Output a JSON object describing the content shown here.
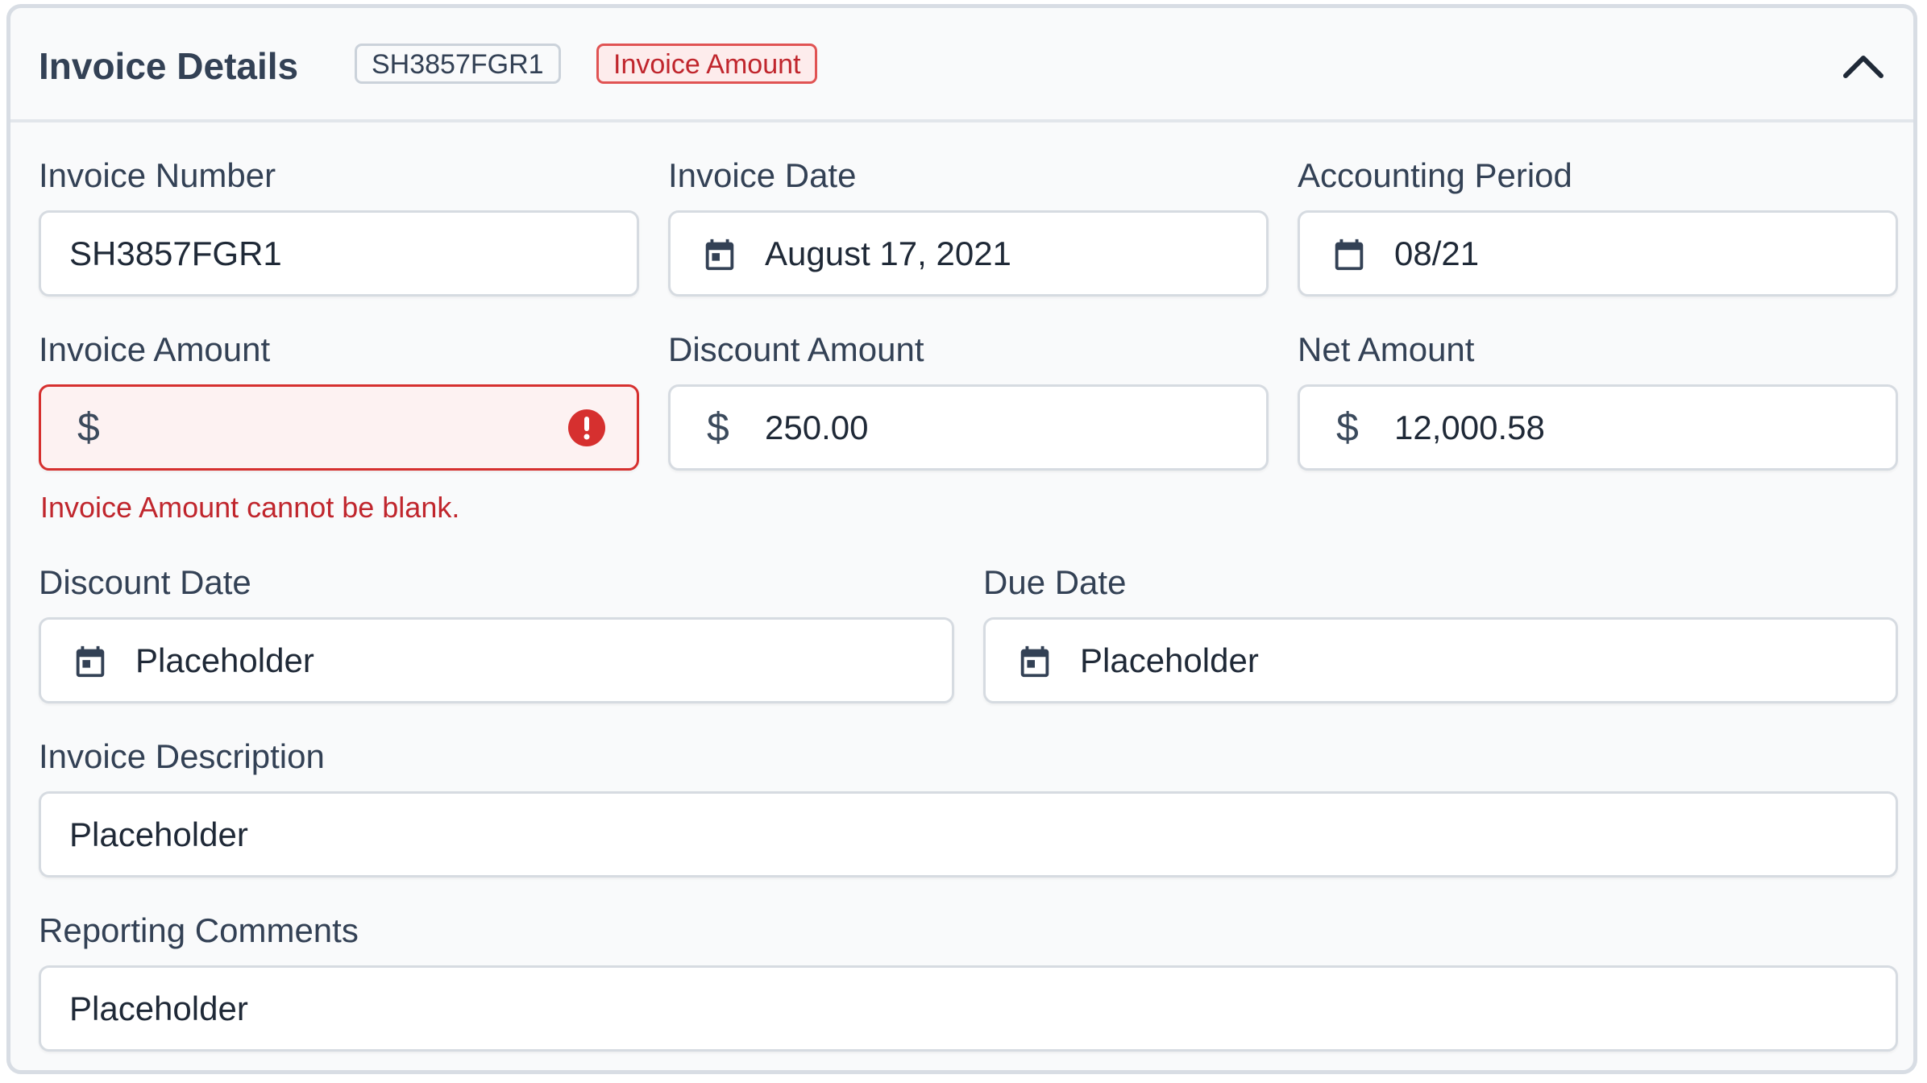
{
  "header": {
    "title": "Invoice Details",
    "badges": {
      "invoice_id": "SH3857FGR1",
      "error_tag": "Invoice Amount"
    },
    "collapse_icon": "chevron-up-icon"
  },
  "fields": {
    "invoice_number": {
      "label": "Invoice Number",
      "value": "SH3857FGR1"
    },
    "invoice_date": {
      "label": "Invoice Date",
      "value": "August 17, 2021",
      "icon": "calendar-icon"
    },
    "accounting_period": {
      "label": "Accounting Period",
      "value": "08/21",
      "icon": "calendar-icon"
    },
    "invoice_amount": {
      "label": "Invoice Amount",
      "prefix": "$",
      "value": "",
      "error": "Invoice Amount cannot be blank.",
      "icon": "error-icon"
    },
    "discount_amount": {
      "label": "Discount Amount",
      "prefix": "$",
      "value": "250.00"
    },
    "net_amount": {
      "label": "Net Amount",
      "prefix": "$",
      "value": "12,000.58"
    },
    "discount_date": {
      "label": "Discount Date",
      "placeholder": "Placeholder",
      "icon": "calendar-icon"
    },
    "due_date": {
      "label": "Due Date",
      "placeholder": "Placeholder",
      "icon": "calendar-icon"
    },
    "invoice_description": {
      "label": "Invoice Description",
      "placeholder": "Placeholder"
    },
    "reporting_comments": {
      "label": "Reporting Comments",
      "placeholder": "Placeholder"
    }
  },
  "colors": {
    "text": "#334155",
    "error": "#c0262d",
    "error_border": "#d6302f",
    "border": "#d6dbe1",
    "panel_bg": "#f9fafb"
  }
}
